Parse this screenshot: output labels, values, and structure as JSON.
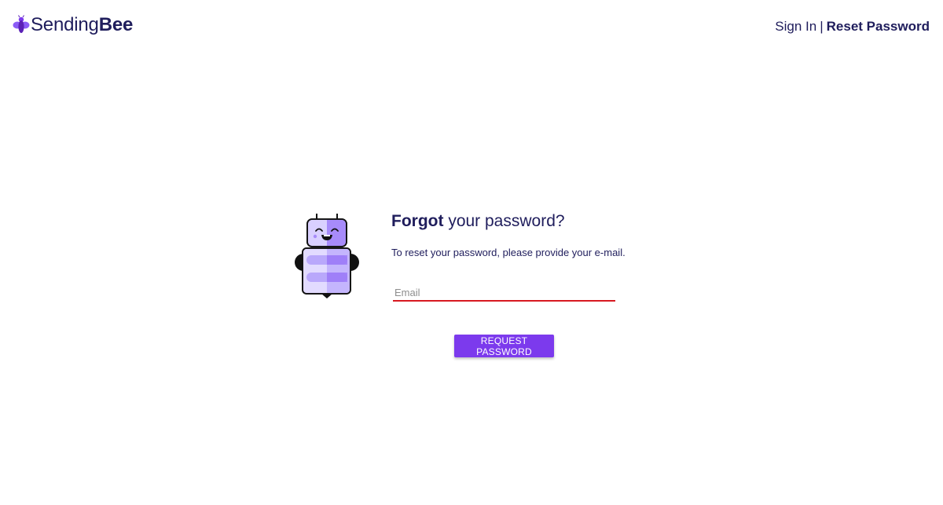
{
  "brand": {
    "name_light": "Sending",
    "name_bold": "Bee",
    "accent": "#7c3aed",
    "text_color": "#1f1d5c",
    "icon": "bee-logo-icon"
  },
  "nav": {
    "sign_in": "Sign In",
    "separator": "|",
    "reset_password": "Reset Password"
  },
  "illustration": {
    "icon": "robot-illustration"
  },
  "form": {
    "title_bold": "Forgot",
    "title_rest": " your password?",
    "subtitle": "To reset your password, please provide your e-mail.",
    "email_placeholder": "Email",
    "email_value": "",
    "error_color": "#d71920",
    "submit_label": "REQUEST PASSWORD"
  }
}
